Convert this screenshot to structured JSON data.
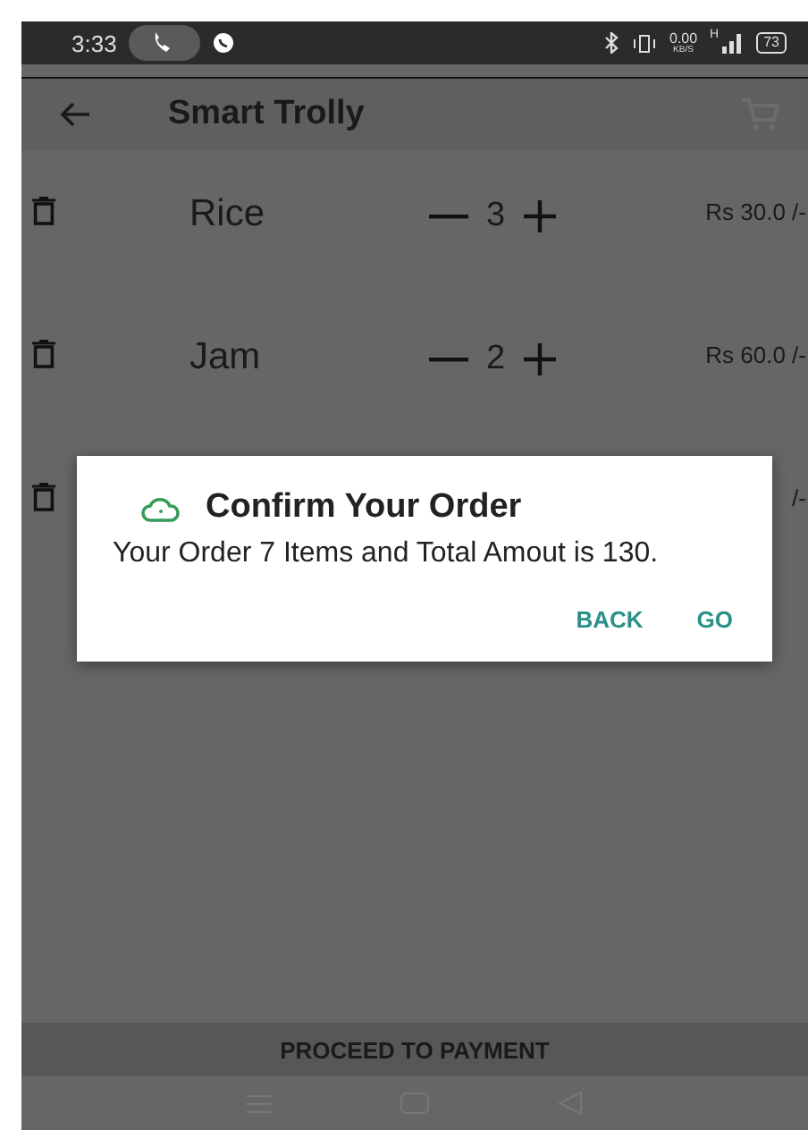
{
  "status_bar": {
    "time": "3:33",
    "speed": "0.00",
    "speed_unit": "KB/S",
    "network": "H",
    "battery": "73"
  },
  "app_bar": {
    "title": "Smart Trolly"
  },
  "items": [
    {
      "name": "Rice",
      "quantity": "3",
      "price": "Rs 30.0 /-"
    },
    {
      "name": "Jam",
      "quantity": "2",
      "price": "Rs 60.0 /-"
    },
    {
      "price": "/-"
    }
  ],
  "dialog": {
    "title": "Confirm Your Order",
    "message": "Your Order 7 Items and Total Amout is 130.",
    "buttons": [
      "BACK",
      "GO"
    ]
  },
  "bottom_button": "PROCEED TO PAYMENT"
}
